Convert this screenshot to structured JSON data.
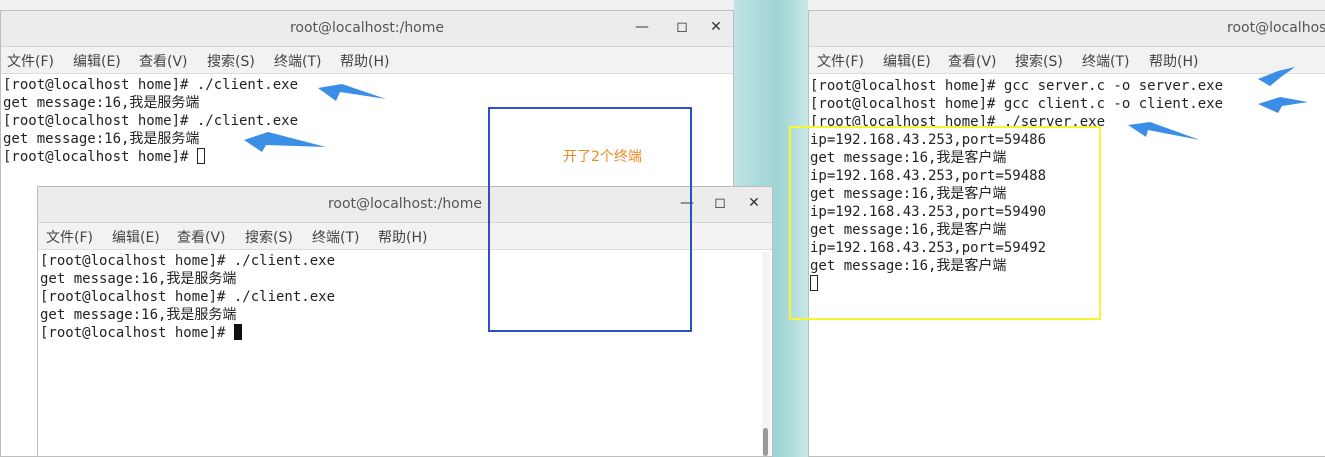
{
  "colors": {
    "arrow": "#3a8ee6",
    "blue_box": "#2b4fc7",
    "yellow_box": "#f5f532",
    "note_text": "#f08a24"
  },
  "menu": [
    "文件(F)",
    "编辑(E)",
    "查看(V)",
    "搜索(S)",
    "终端(T)",
    "帮助(H)"
  ],
  "window_controls": {
    "minimize": "—",
    "maximize": "◻",
    "close": "✕"
  },
  "win1": {
    "title": "root@localhost:/home",
    "lines": [
      "[root@localhost home]# ./client.exe",
      "get message:16,我是服务端",
      "[root@localhost home]# ./client.exe",
      "get message:16,我是服务端",
      "[root@localhost home]# "
    ]
  },
  "win2": {
    "title": "root@localhost:/home",
    "lines": [
      "[root@localhost home]# ./client.exe",
      "get message:16,我是服务端",
      "[root@localhost home]# ./client.exe",
      "get message:16,我是服务端",
      "[root@localhost home]# "
    ]
  },
  "win3": {
    "title": "root@localhost:/home",
    "lines": [
      "[root@localhost home]# gcc server.c -o server.exe",
      "[root@localhost home]# gcc client.c -o client.exe",
      "[root@localhost home]# ./server.exe",
      "ip=192.168.43.253,port=59486",
      "get message:16,我是客户端",
      "ip=192.168.43.253,port=59488",
      "get message:16,我是客户端",
      "ip=192.168.43.253,port=59490",
      "get message:16,我是客户端",
      "ip=192.168.43.253,port=59492",
      "get message:16,我是客户端"
    ]
  },
  "annotation": {
    "note": "开了2个终端"
  }
}
